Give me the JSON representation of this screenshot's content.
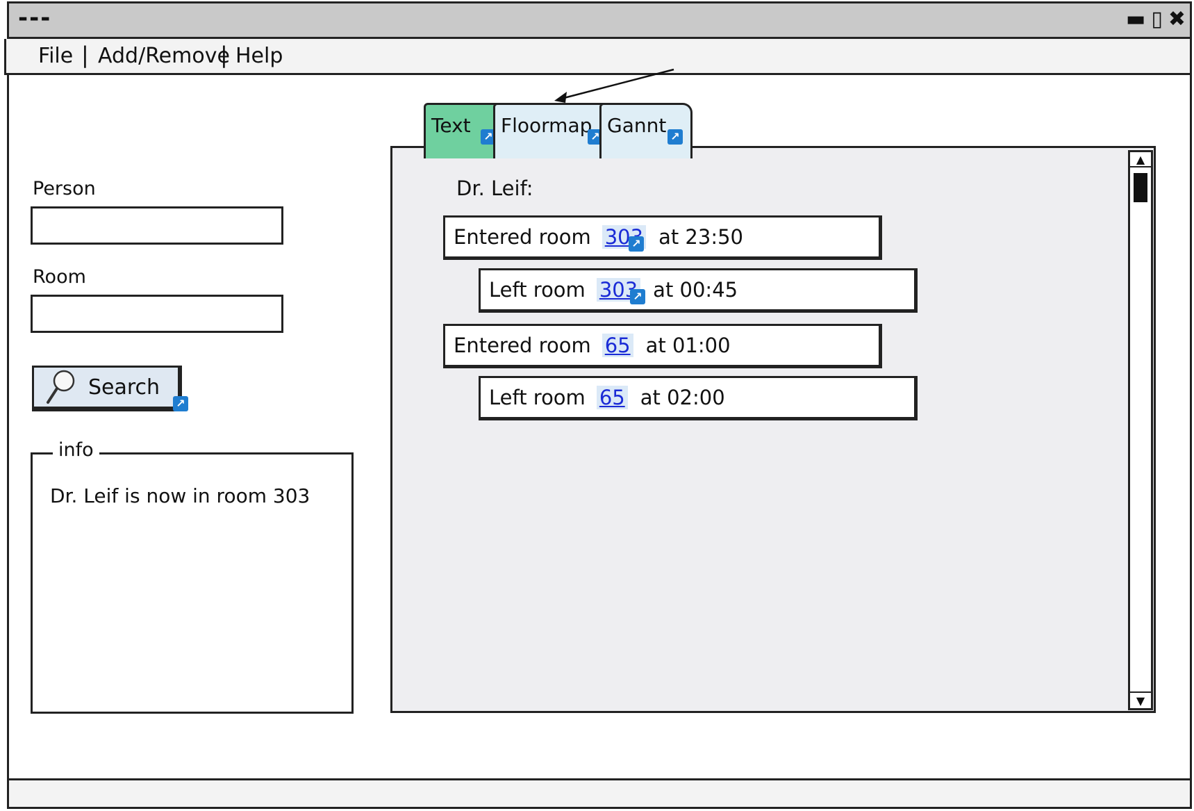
{
  "window": {
    "title": "---",
    "controls": {
      "minimize": "▬",
      "maximize": "▯",
      "close": "✖"
    }
  },
  "menu": {
    "file": "File",
    "add_remove": "Add/Remove",
    "help": "Help",
    "separator": "|"
  },
  "search_form": {
    "person_label": "Person",
    "person_value": "",
    "room_label": "Room",
    "room_value": "",
    "search_button": "Search"
  },
  "info_panel": {
    "legend": "info",
    "text": "Dr. Leif is now in room 303"
  },
  "tabs": [
    {
      "label": "Text",
      "active": true,
      "color": "#6fd09f"
    },
    {
      "label": "Floormap",
      "active": false,
      "color": "#dfeef6"
    },
    {
      "label": "Gannt",
      "active": false,
      "color": "#dfeef6"
    }
  ],
  "content": {
    "heading": "Dr. Leif:",
    "events": [
      {
        "action": "Entered room",
        "room": "303",
        "time": "at 23:50"
      },
      {
        "action": "Left room",
        "room": "303",
        "time": "at 00:45"
      },
      {
        "action": "Entered room",
        "room": "65",
        "time": "at 01:00"
      },
      {
        "action": "Left room",
        "room": "65",
        "time": "at 02:00"
      }
    ]
  },
  "scrollbar": {
    "up": "▲",
    "down": "▼"
  },
  "colors": {
    "active_tab": "#6fd09f",
    "inactive_tab": "#dfeef6",
    "link": "#1a2bd6",
    "link_badge": "#1f7dd0",
    "title_bar": "#c9c9c9",
    "content_background": "#eeeef1"
  },
  "icons": {
    "search_button": "magnifier-icon",
    "link_badge": "link-arrow-icon"
  }
}
